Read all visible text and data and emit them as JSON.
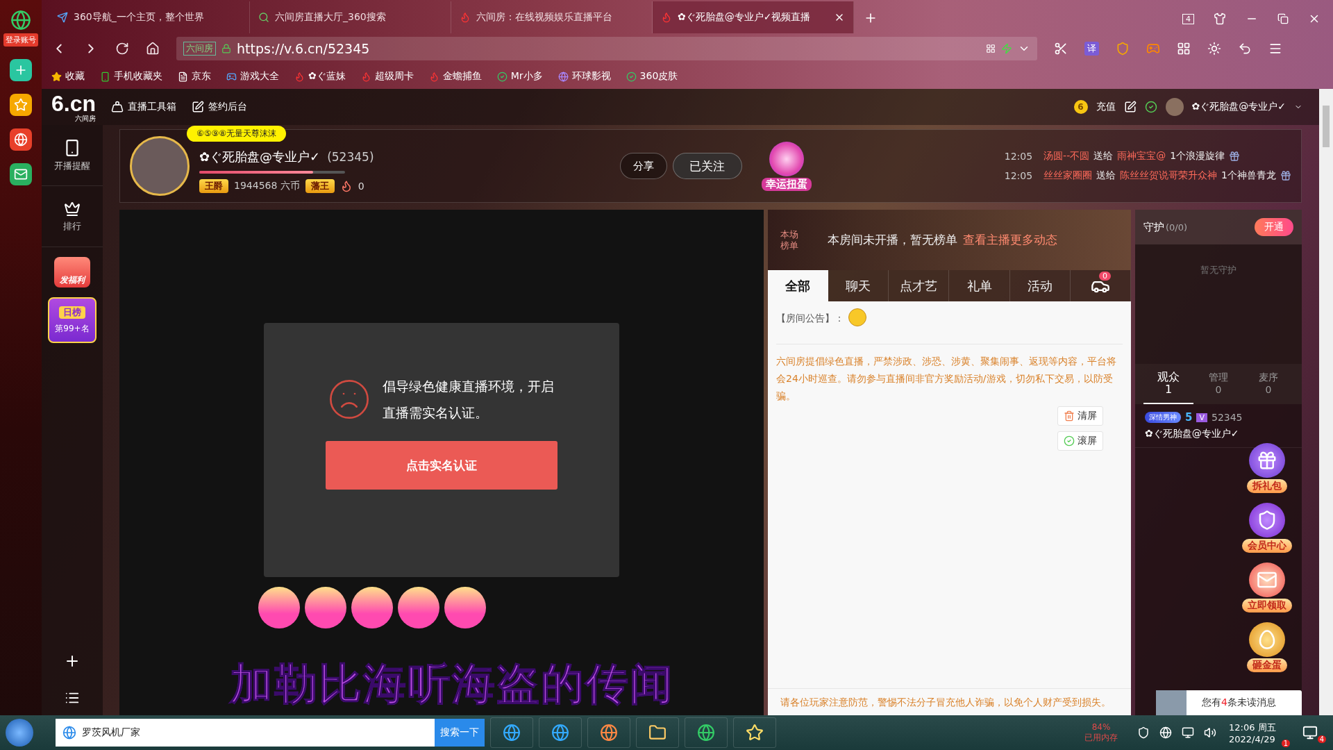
{
  "side_panel": {
    "login_label": "登录账号"
  },
  "browser": {
    "tabs": [
      {
        "title": "360导航_一个主页，整个世界",
        "selected": false
      },
      {
        "title": "六间房直播大厅_360搜索",
        "selected": false
      },
      {
        "title": "六间房：在线视频娱乐直播平台",
        "selected": false
      },
      {
        "title": "✿ぐ死胎盘@专业户✓视频直播",
        "selected": true
      }
    ],
    "tab_count": "4",
    "site_label": "六间房",
    "url": "https://v.6.cn/52345",
    "translate_label": "译",
    "bookmarks": [
      "收藏",
      "手机收藏夹",
      "京东",
      "游戏大全",
      "✿ぐ蓝妹",
      "超级周卡",
      "金蟾捕鱼",
      "Mr小多",
      "环球影视",
      "360皮肤"
    ]
  },
  "header": {
    "logo": "6.cn",
    "logo_caption": "六间房",
    "tools": [
      "直播工具箱",
      "签约后台"
    ],
    "coin": "6",
    "recharge": "充值",
    "username": "✿ぐ死胎盘@专业户✓"
  },
  "left_nav": {
    "items": [
      {
        "label": "开播提醒",
        "kind": "phone"
      },
      {
        "label": "排行",
        "kind": "crown"
      }
    ],
    "welfare": "发福利",
    "daily_rank": {
      "title": "日榜",
      "rank": "第99+名"
    }
  },
  "anchor": {
    "badge": "⑥⑤⑨⑧无量天尊沫沫",
    "name": "✿ぐ死胎盘@专业户✓",
    "room_id": "(52345)",
    "title_tag": "王爵",
    "coins": "1944568 六币",
    "rank_tag": "藩王",
    "fire": "0",
    "level": 0.78,
    "share": "分享",
    "follow": "已关注",
    "lucky": "幸运扭蛋",
    "feed": [
      {
        "time": "12:05",
        "from": "汤圆--不圆",
        "verb": "送给",
        "to": "雨神宝宝@",
        "gift": "1个浪漫旋律"
      },
      {
        "time": "12:05",
        "from": "丝丝家圈圈",
        "verb": "送给",
        "to": "陈丝丝贺说哥荣升众神",
        "gift": "1个神兽青龙"
      }
    ]
  },
  "video": {
    "message": "倡导绿色健康直播环境，开启直播需实名认证。",
    "button": "点击实名认证",
    "caption": "加勒比海听海盗的传闻"
  },
  "chat": {
    "rank_label": "本场榜单",
    "rank_text": "本房间未开播，暂无榜单",
    "rank_link": "查看主播更多动态",
    "tabs": [
      {
        "label": "全部",
        "kind": "text",
        "selected": true
      },
      {
        "label": "聊天",
        "kind": "text",
        "selected": false
      },
      {
        "label": "点才艺",
        "kind": "text",
        "selected": false
      },
      {
        "label": "礼单",
        "kind": "text",
        "selected": false
      },
      {
        "label": "活动",
        "kind": "text",
        "selected": false
      },
      {
        "label": "0",
        "kind": "car",
        "selected": false
      }
    ],
    "announcement": "【房间公告】：",
    "notice": "六间房提倡绿色直播，严禁涉政、涉恐、涉黄、聚集闹事、返现等内容，平台将会24小时巡查。请勿参与直播间非官方奖励活动/游戏，切勿私下交易，以防受骗。",
    "clear": "清屏",
    "scroll": "滚屏",
    "warning": "请各位玩家注意防范，警惕不法分子冒充他人诈骗，以免个人财产受到损失。"
  },
  "guard": {
    "title": "守护",
    "count": "(0/0)",
    "open": "开通",
    "empty": "暂无守护",
    "tabs": [
      {
        "label": "观众",
        "count": "1",
        "selected": true
      },
      {
        "label": "管理",
        "count": "0",
        "selected": false
      },
      {
        "label": "麦序",
        "count": "0",
        "selected": false
      }
    ],
    "viewers": [
      {
        "tag": "深情男神",
        "level": "5",
        "vip": "V",
        "id": "52345",
        "name": "✿ぐ死胎盘@专业户✓"
      }
    ],
    "floats": [
      "拆礼包",
      "会员中心",
      "立即领取",
      "砸金蛋"
    ],
    "unread": {
      "before": "您有",
      "count": "4",
      "after": "条未读消息"
    }
  },
  "taskbar": {
    "search": "罗茨风机厂家",
    "search_button": "搜索一下",
    "memory": "84%",
    "memory_label": "已用内存",
    "time": "12:06 周五",
    "date": "2022/4/29",
    "badges": [
      "1",
      "4"
    ]
  }
}
